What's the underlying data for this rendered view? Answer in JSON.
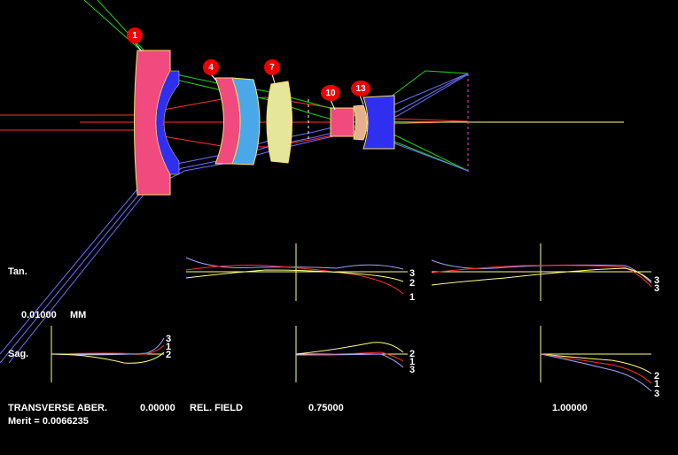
{
  "surface_tags": [
    "1",
    "4",
    "7",
    "10",
    "13"
  ],
  "row_labels": {
    "tan": "Tan.",
    "sag": "Sag."
  },
  "scale": {
    "value": "0.01000",
    "unit": "MM"
  },
  "footer": {
    "aberration_label": "TRANSVERSE ABER.",
    "field_zero": "0.00000",
    "rel_field_label": "REL. FIELD",
    "field_mid": "0.75000",
    "field_full": "1.00000",
    "merit": "Merit = 0.0066235"
  },
  "curve_labels": {
    "tan_mid": [
      "3",
      "2",
      "1"
    ],
    "tan_right": [
      "3",
      "3"
    ],
    "sag_left": [
      "3",
      "1",
      "2"
    ],
    "sag_mid": [
      "2",
      "1",
      "3"
    ],
    "sag_right": [
      "2",
      "1",
      "3"
    ]
  },
  "colors": {
    "background": "#000000",
    "element_pink": "#f04a7f",
    "element_blue": "#2f2ff0",
    "element_cyan": "#4aa8e8",
    "element_yellow": "#e6e69a",
    "ray_red": "#ff3030",
    "ray_green": "#20d020",
    "ray_blue": "#7070ff",
    "axis": "#ffff80",
    "tag": "#e00000"
  }
}
